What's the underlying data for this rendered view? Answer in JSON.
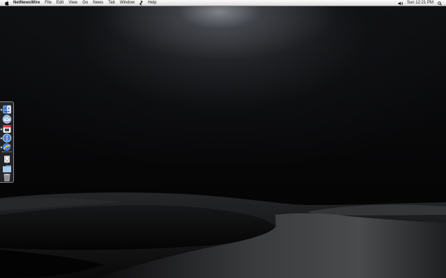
{
  "menubar": {
    "app_name": "NetNewsWire",
    "items": [
      "File",
      "Edit",
      "View",
      "Go",
      "News",
      "Tab",
      "Window",
      "Help"
    ],
    "clock": "Sun 12:21 PM"
  },
  "icons": {
    "apple": "apple-icon",
    "script": "script-menu-icon",
    "volume": "volume-icon",
    "spotlight": "spotlight-icon"
  },
  "dock": {
    "apps": [
      {
        "name": "finder-icon",
        "color": "#5b8fd6"
      },
      {
        "name": "mail-icon",
        "color": "#8fb2d8"
      },
      {
        "name": "calendar-icon",
        "color": "#d94040"
      },
      {
        "name": "safari-icon",
        "color": "#3b86d6"
      },
      {
        "name": "netnewswire-icon",
        "color": "#3f7fe0"
      }
    ],
    "others": [
      {
        "name": "preview-icon",
        "color": "#dddddd"
      },
      {
        "name": "documents-folder-icon",
        "color": "#7aa7d8"
      },
      {
        "name": "trash-icon",
        "color": "#9a9a9a"
      }
    ]
  }
}
